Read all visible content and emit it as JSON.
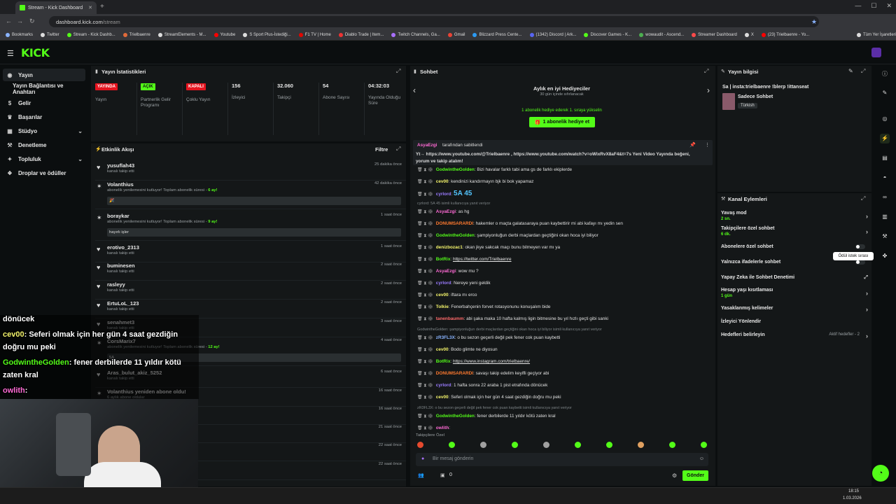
{
  "browser": {
    "tab_title": "Stream - Kick Dashboard",
    "url_host": "dashboard.kick.com",
    "url_path": "/stream",
    "bookmarks": [
      "Bookmarks",
      "Twitter",
      "Stream - Kick Dashb...",
      "Trielbaenre",
      "StreamElements - M...",
      "Youtube",
      "S Sport Plus-İstediği...",
      "F1 TV | Home",
      "Diablo Trade | Item...",
      "Twitch Channels, Ga...",
      "Gmail",
      "Blizzard Press Cente...",
      "(1342) Discord | Ark...",
      "Discover Games - K...",
      "wowaudit - Ascend...",
      "Streamer Dashboard",
      "X",
      "(23) Trielbaenre - Yo...",
      "Tüm Yer İşaretleri"
    ]
  },
  "app": {
    "logo": "KICK"
  },
  "sidebar": {
    "items": [
      {
        "label": "Yayın",
        "icon": "broadcast-icon"
      },
      {
        "label": "Yayın Bağlantısı ve Anahtarı",
        "icon": ""
      },
      {
        "label": "Gelir",
        "icon": "money-icon"
      },
      {
        "label": "Başarılar",
        "icon": "trophy-icon"
      },
      {
        "label": "Stüdyo",
        "icon": "studio-icon"
      },
      {
        "label": "Denetleme",
        "icon": "hammer-icon"
      },
      {
        "label": "Topluluk",
        "icon": "community-icon"
      },
      {
        "label": "Droplar ve ödüller",
        "icon": "gift-icon"
      }
    ]
  },
  "stats": {
    "title": "Yayın İstatistikleri",
    "cols": [
      {
        "badge": "YAYINDA",
        "label": "Yayın"
      },
      {
        "badge": "AÇIK",
        "label": "Partnerlik Gelir Programı"
      },
      {
        "badge": "KAPALI",
        "label": "Çoklu Yayın"
      },
      {
        "value": "156",
        "label": "İzleyici"
      },
      {
        "value": "32.060",
        "label": "Takipçi"
      },
      {
        "value": "54",
        "label": "Abone Sayısı"
      },
      {
        "value": "04:32:03",
        "label": "Yayında Olduğu Süre"
      }
    ]
  },
  "activity": {
    "title": "Etkinlik Akışı",
    "filter": "Filtre",
    "rows": [
      {
        "name": "yusuflah43",
        "sub": "kanalı takip etti",
        "time": "25 dakika önce"
      },
      {
        "name": "Volanthius",
        "sub": "abonelik yenilemesini kutluyor! Toplam abonelik süresi - ",
        "months": "6 ay!",
        "time": "42 dakika önce",
        "msg": "🎉"
      },
      {
        "name": "boraykar",
        "sub": "abonelik yenilemesini kutluyor! Toplam abonelik süresi - ",
        "months": "9 ay!",
        "time": "1 saat önce",
        "msg": "hayırlı işler"
      },
      {
        "name": "erotivo_2313",
        "sub": "kanalı takip etti",
        "time": "1 saat önce"
      },
      {
        "name": "buminesen",
        "sub": "kanalı takip etti",
        "time": "2 saat önce"
      },
      {
        "name": "rasleyy",
        "sub": "kanalı takip etti",
        "time": "2 saat önce"
      },
      {
        "name": "ErtuLoL_123",
        "sub": "kanalı takip etti",
        "time": "2 saat önce"
      },
      {
        "name": "senahmet3",
        "sub": "kanalı takip etti",
        "time": "3 saat önce"
      },
      {
        "name": "CorsMarix7",
        "sub": "abonelik yenilemesini kutluyor! Toplam abonelik süresi - ",
        "months": "12 ay!",
        "time": "4 saat önce",
        "msg": "5A"
      },
      {
        "name": "Aras_bulut_akiz_5252",
        "sub": "kanalı takip etti",
        "time": "6 saat önce"
      },
      {
        "name": "Volanthius yeniden abone oldu!",
        "sub": "6 aylık abone oldular",
        "time": "16 saat önce"
      },
      {
        "name": "",
        "sub": "",
        "time": "16 saat önce"
      },
      {
        "name": "",
        "sub": "",
        "time": "21 saat önce"
      },
      {
        "name": "",
        "sub": "",
        "time": "22 saat önce"
      },
      {
        "name": "",
        "sub": "",
        "time": "22 saat önce"
      }
    ]
  },
  "chat": {
    "title": "Sohbet",
    "gift_header": "Aylık en iyi Hediyeciler",
    "gift_sub": "30 gün içinde sıfırlanacak",
    "gift_line": "1 abonelik hediye ederek 1. sıraya yükselin",
    "gift_btn": "1 abonelik hediye et",
    "pinned_by": "AsyaEzgi",
    "pinned_suffix": "tarafından sabitlendi",
    "pinned_text": "Yt→ https://www.youtube.com/@Trielbaenre  ,  https://www.youtube.com/watch?v=oWixRvX8aF4&t=7s Yeni Video Yayında  beğeni, yorum ve takip atalım!",
    "lines": [
      {
        "user": "GodwintheGolden",
        "color": "#53fc18",
        "text": "Bizi havalar farklı tabi ama gs de farklı ekiplerde"
      },
      {
        "user": "cev00",
        "color": "#f4f46b",
        "text": "kendinizi kandırmayın bjk bi bok yapamaz"
      },
      {
        "user": "cyrlord",
        "color": "#9b7bff",
        "text": "5A 45"
      },
      {
        "reply": "cyrlord: 5A 45 isimli kullanıcıya yanıt veriyor"
      },
      {
        "user": "AsyaEzgi",
        "color": "#ff6ad5",
        "text": "as hg"
      },
      {
        "user": "DONUMSARARDI",
        "color": "#ff7a2f",
        "text": "hakemler o maçta galatasaraya puan kaybettirir mi abi kafayı mı yedin sen"
      },
      {
        "user": "GodwintheGolden",
        "color": "#53fc18",
        "text": "şampiyonluğun derbi maçlardan geçtiğini okan hoca iyi biliyor"
      },
      {
        "user": "denizbozac1",
        "color": "#f4f46b",
        "text": "okan jkye sakcak maçı bunu bilmeyen var mı ya"
      },
      {
        "user": "BotRix",
        "color": "#53fc18",
        "link": "https://twitter.com/Trielbaenre"
      },
      {
        "user": "AsyaEzgi",
        "color": "#ff6ad5",
        "text": "wow mu ?"
      },
      {
        "user": "cyrlord",
        "color": "#9b7bff",
        "text": "Nereye yeni geldik"
      },
      {
        "user": "cev00",
        "color": "#f4f46b",
        "text": "iftara mı erco"
      },
      {
        "user": "Tolkie",
        "color": "#f4f46b",
        "text": "Fenerbahçenin forvet rotasyonunu konuşalım bide"
      },
      {
        "user": "tanenbaumm",
        "color": "#ff6a6a",
        "text": "abi şaka maka 10 hafta kalmış ligin bitmesine bu yıl hızlı geçti gibi sanki"
      },
      {
        "reply": "GodwintheGolden: şampiyonluğun derbi maçlardan geçtiğini okan hoca iyi biliyor isimli kullanıcıya yanıt veriyor"
      },
      {
        "user": "zR3FL3X",
        "color": "#8ab4ff",
        "text": "o bu sezon geçerli değil pek fener cok puan kaybetti"
      },
      {
        "user": "cev00",
        "color": "#f4f46b",
        "text": "Bodo glimte ne diyosun"
      },
      {
        "user": "BotRix",
        "color": "#53fc18",
        "link": "https://www.instagram.com/trielbaenre/"
      },
      {
        "user": "DONUMSARARDI",
        "color": "#ff7a2f",
        "text": "savaşı takip edelim keyifli geçiyor abi"
      },
      {
        "user": "cyrlord",
        "color": "#9b7bff",
        "text": "1 hafta sonra 22 araba 1 pist etrafında dönücek"
      },
      {
        "user": "cev00",
        "color": "#f4f46b",
        "text": "Seferi olmak için her gün 4 saat gezdiğin doğru mu peki"
      },
      {
        "reply": "zR3FL3X: o bu sezon geçerli değil pek fener cok puan kaybetti isimli kullanıcıya yanıt veriyor"
      },
      {
        "user": "GodwintheGolden",
        "color": "#53fc18",
        "text": "fener derbilerde 11 yıldır kötü zaten kral"
      },
      {
        "user": "owlith",
        "color": "#ff6ad5",
        "text": ""
      }
    ],
    "followers_mode": "Takipçilere Özel",
    "input_placeholder": "Bir mesaj gönderin",
    "points": "0",
    "send_btn": "Gönder"
  },
  "stream_info": {
    "title": "Yayın bilgisi",
    "stream_title": "Sa | insta:trielbaenre !blerp !ittanseat",
    "category": "Sadece Sohbet",
    "tag": "Türkish"
  },
  "channel_actions": {
    "title": "Kanal Eylemleri",
    "rows": [
      {
        "label": "Yavaş mod",
        "sub": "2 sn.",
        "control": "chevron"
      },
      {
        "label": "Takipçilere özel sohbet",
        "sub": "6 dk.",
        "control": "chevron"
      },
      {
        "label": "Abonelere özel sohbet",
        "control": "toggle"
      },
      {
        "label": "Yalnızca ifadelerle sohbet",
        "control": "toggle"
      },
      {
        "label": "Yapay Zeka ile Sohbet Denetimi",
        "control": "external"
      },
      {
        "label": "Hesap yaşı kısıtlaması",
        "sub": "1 gün",
        "control": "chevron"
      },
      {
        "label": "Yasaklanmış kelimeler",
        "control": "chevron"
      },
      {
        "label": "İzleyici Yönlendir",
        "control": ""
      },
      {
        "label": "Hedefleri belirleyin",
        "extra": "Aktif hedefler - 2",
        "control": "chevron"
      }
    ],
    "tooltip": "Ödül istek sırası"
  },
  "overlay": {
    "lines": [
      {
        "user": "",
        "text": "dönücek"
      },
      {
        "user": "cev00",
        "text": ": Seferi olmak için her gün 4 saat gezdiğin"
      },
      {
        "user": "",
        "text": "doğru mu peki"
      },
      {
        "user": "GodwintheGolden",
        "text": ": fener derbilerde 11 yıldır kötü"
      },
      {
        "user": "",
        "text": "zaten kral"
      },
      {
        "user": "owlith",
        "text": ":"
      }
    ]
  },
  "taskbar": {
    "time": "18:15",
    "date": "1.03.2026"
  },
  "colors": {
    "accent": "#53fc18",
    "live": "#e5141f",
    "panel": "#141718"
  }
}
